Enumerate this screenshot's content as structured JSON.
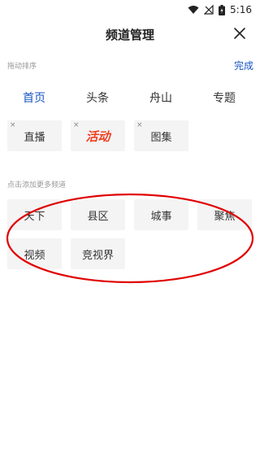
{
  "status": {
    "time": "5:16"
  },
  "header": {
    "title": "频道管理"
  },
  "my_channels": {
    "label": "拖动排序",
    "done_label": "完成",
    "fixed_tabs": [
      {
        "label": "首页",
        "active": true
      },
      {
        "label": "头条",
        "active": false
      },
      {
        "label": "舟山",
        "active": false
      },
      {
        "label": "专题",
        "active": false
      }
    ],
    "chips": [
      {
        "label": "直播"
      },
      {
        "label": "活动"
      },
      {
        "label": "图集"
      }
    ],
    "remove_glyph": "×"
  },
  "more_channels": {
    "label": "点击添加更多频道",
    "chips": [
      {
        "label": "天下"
      },
      {
        "label": "县区"
      },
      {
        "label": "城事"
      },
      {
        "label": "聚焦"
      },
      {
        "label": "视频"
      },
      {
        "label": "竞视界"
      }
    ]
  },
  "colors": {
    "accent": "#1a56c4",
    "activity": "#f04020",
    "annotation": "#e00000"
  }
}
